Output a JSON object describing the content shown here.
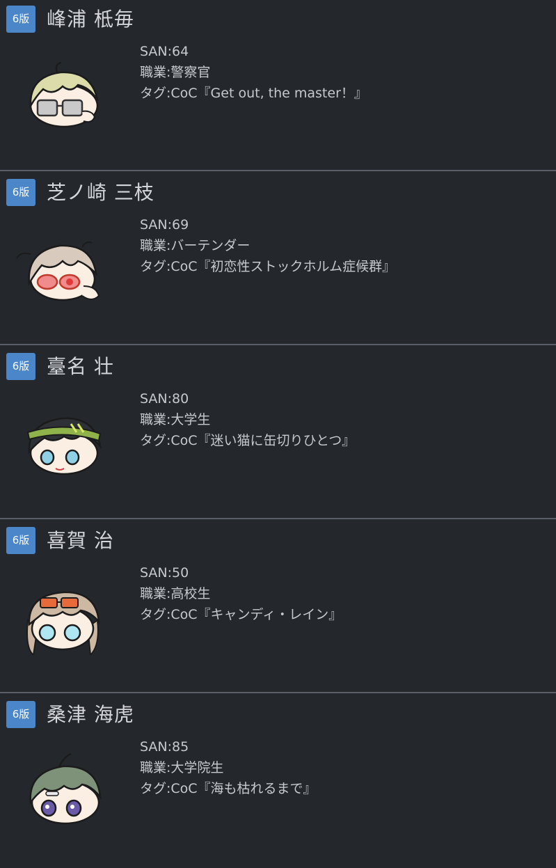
{
  "characters": [
    {
      "badge": "6版",
      "name": "峰浦 柢毎",
      "san": "SAN:64",
      "job": "職業:警察官",
      "tag": "タグ:CoC『Get out, the master！』",
      "hair_color": "#dcdcaa",
      "eye_color": "#8a8a8a",
      "accessory": "glasses"
    },
    {
      "badge": "6版",
      "name": "芝ノ崎 三枝",
      "san": "SAN:69",
      "job": "職業:バーテンダー",
      "tag": "タグ:CoC『初恋性ストックホルム症候群』",
      "hair_color": "#d8cbbd",
      "eye_color": "#e03a3a",
      "accessory": "red-glasses"
    },
    {
      "badge": "6版",
      "name": "臺名 壮",
      "san": "SAN:80",
      "job": "職業:大学生",
      "tag": "タグ:CoC『迷い猫に缶切りひとつ』",
      "hair_color": "#2e3135",
      "eye_color": "#8fd0e6",
      "accessory": "headband"
    },
    {
      "badge": "6版",
      "name": "喜賀 治",
      "san": "SAN:50",
      "job": "職業:高校生",
      "tag": "タグ:CoC『キャンディ・レイン』",
      "hair_color": "#cdb8a4",
      "eye_color": "#aee6f2",
      "accessory": "sunglasses"
    },
    {
      "badge": "6版",
      "name": "桑津 海虎",
      "san": "SAN:85",
      "job": "職業:大学院生",
      "tag": "タグ:CoC『海も枯れるまで』",
      "hair_color": "#7e927a",
      "eye_color": "#6b5aa8",
      "accessory": "none"
    }
  ]
}
